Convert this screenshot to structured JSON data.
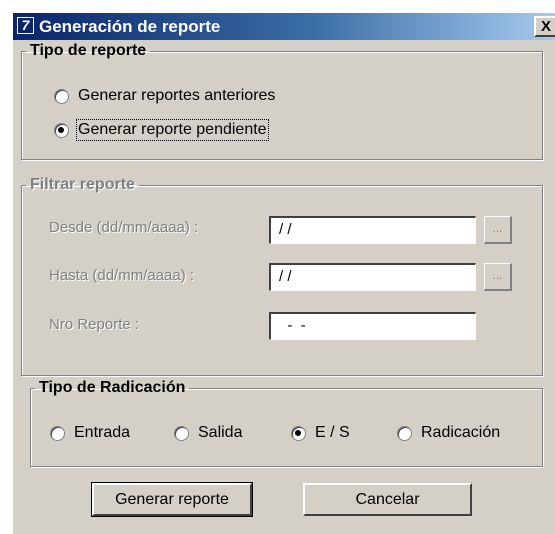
{
  "window": {
    "title": "Generación de reporte",
    "close_label": "X",
    "app_icon_glyph": "7"
  },
  "tipo_reporte": {
    "legend": "Tipo de reporte",
    "options": [
      {
        "label": "Generar reportes anteriores",
        "checked": false
      },
      {
        "label": "Generar reporte pendiente",
        "checked": true
      }
    ]
  },
  "filtrar": {
    "legend": "Filtrar reporte",
    "desde": {
      "label": "Desde (dd/mm/aaaa) :",
      "value": "/ /",
      "picker_label": "..."
    },
    "hasta": {
      "label": "Hasta (dd/mm/aaaa) :",
      "value": "/ /",
      "picker_label": "..."
    },
    "nro": {
      "label": "Nro Reporte :",
      "value": "  -  -"
    }
  },
  "radicacion": {
    "legend": "Tipo de Radicación",
    "options": [
      {
        "label": "Entrada",
        "checked": false
      },
      {
        "label": "Salida",
        "checked": false
      },
      {
        "label": "E / S",
        "checked": true
      },
      {
        "label": "Radicación",
        "checked": false
      }
    ]
  },
  "buttons": {
    "generate": "Generar reporte",
    "cancel": "Cancelar"
  },
  "colors": {
    "title_start": "#0a246a",
    "title_end": "#a6caf0",
    "face": "#d4d0c8",
    "disabled_text": "#808080"
  }
}
